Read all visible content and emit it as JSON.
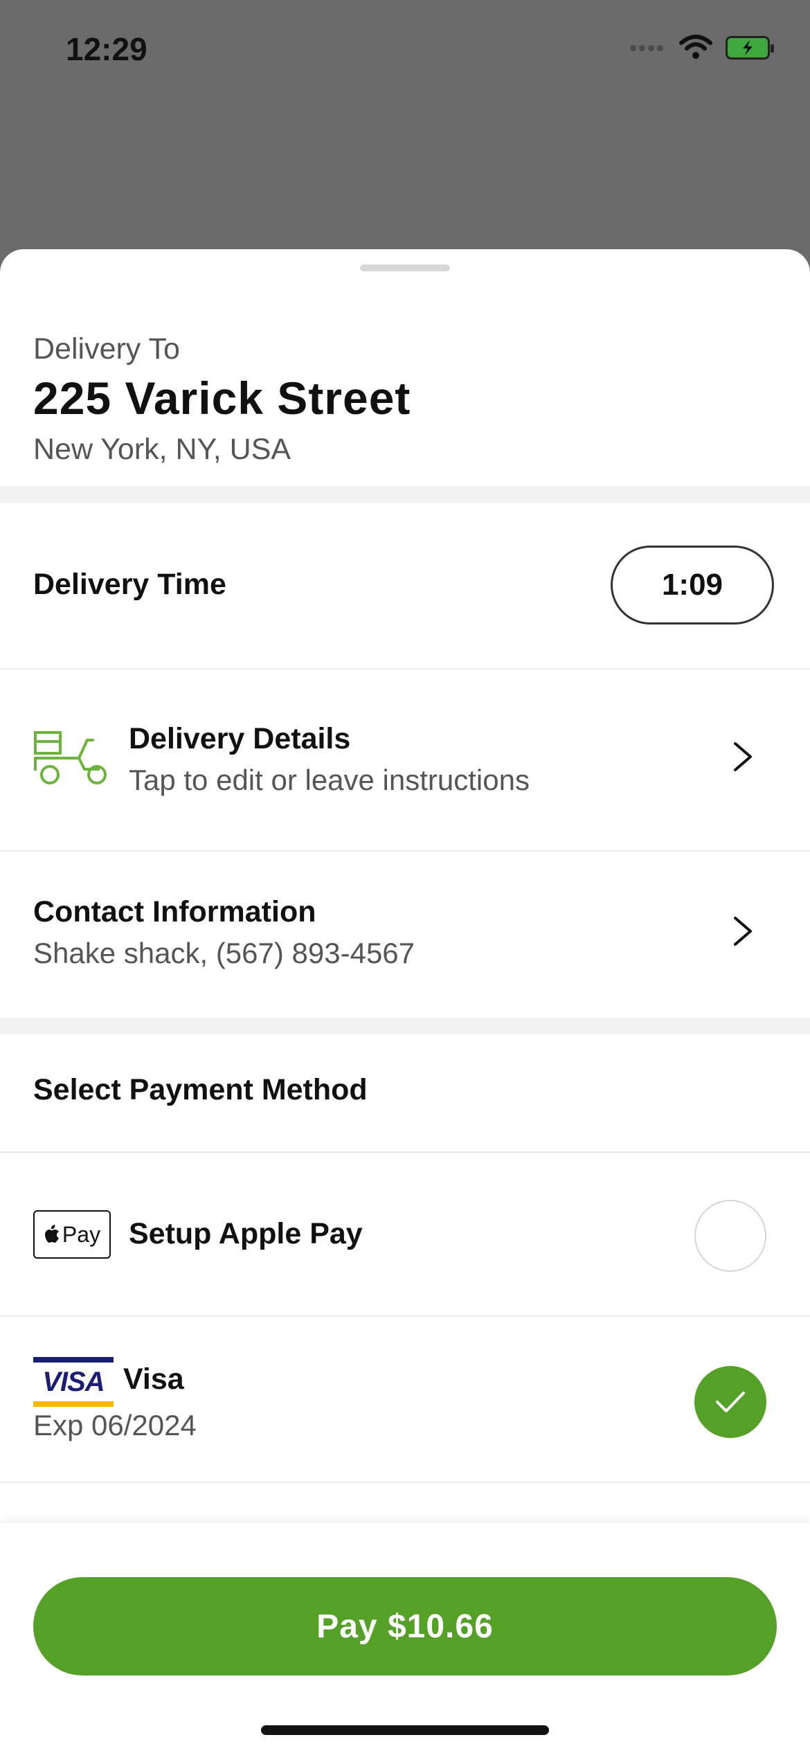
{
  "status_bar": {
    "time": "12:29"
  },
  "sheet": {
    "delivery_to": {
      "label": "Delivery To",
      "street": "225 Varick Street",
      "city": "New York, NY, USA"
    },
    "delivery_time": {
      "label": "Delivery Time",
      "value": "1:09"
    },
    "delivery_details": {
      "title": "Delivery Details",
      "subtitle": "Tap to edit or leave instructions",
      "icon": "scooter-icon"
    },
    "contact_information": {
      "title": "Contact Information",
      "subtitle": "Shake shack, (567) 893-4567"
    },
    "payment": {
      "heading": "Select Payment Method",
      "methods": [
        {
          "badge": "Pay",
          "label": "Setup Apple Pay",
          "selected": false
        },
        {
          "brand": "VISA",
          "label": "Visa",
          "subtitle": "Exp 06/2024",
          "selected": true
        }
      ]
    },
    "pay_button": {
      "label": "Pay $10.66"
    }
  },
  "colors": {
    "accent_green": "#55a127",
    "battery_green": "#3ea83e",
    "visa_blue": "#1a1f71",
    "visa_gold": "#f7b600"
  }
}
